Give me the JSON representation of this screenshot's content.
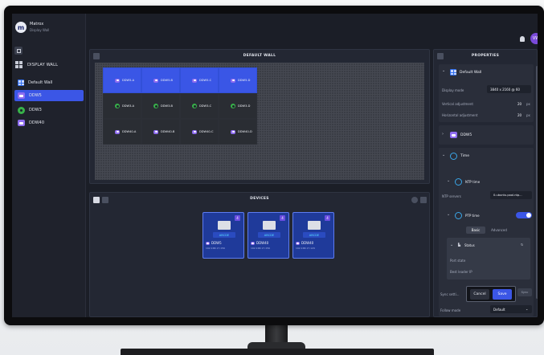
{
  "app": {
    "name": "Matrox",
    "subtitle": "Display Wall",
    "user_initials": "VW"
  },
  "sidebar": {
    "section_label": "DISPLAY WALL",
    "items": [
      {
        "label": "Default Wall",
        "kind": "wall",
        "active": false
      },
      {
        "label": "DDW5",
        "kind": "device",
        "active": true
      },
      {
        "label": "DDW3",
        "kind": "gear",
        "active": false
      },
      {
        "label": "DDW40",
        "kind": "device",
        "active": false
      }
    ]
  },
  "wall": {
    "title": "DEFAULT WALL",
    "tiles": [
      {
        "label": "DDW5-A",
        "style": "blue",
        "icon": "device"
      },
      {
        "label": "DDW5-B",
        "style": "blue",
        "icon": "device"
      },
      {
        "label": "DDW5-C",
        "style": "blue",
        "icon": "device"
      },
      {
        "label": "DDW5-D",
        "style": "blue",
        "icon": "device"
      },
      {
        "label": "DDW3-A",
        "style": "dark",
        "icon": "gear"
      },
      {
        "label": "DDW3-B",
        "style": "dark",
        "icon": "gear"
      },
      {
        "label": "DDW3-C",
        "style": "dark",
        "icon": "gear"
      },
      {
        "label": "DDW3-D",
        "style": "dark",
        "icon": "gear"
      },
      {
        "label": "DDW40-A",
        "style": "dark",
        "icon": "device"
      },
      {
        "label": "DDW40-B",
        "style": "dark",
        "icon": "device"
      },
      {
        "label": "DDW40-C",
        "style": "dark",
        "icon": "device"
      },
      {
        "label": "DDW40-D",
        "style": "dark",
        "icon": "device"
      }
    ]
  },
  "devices": {
    "title": "DEVICES",
    "cards": [
      {
        "badge": "4",
        "code": "ABCDE",
        "name": "DDW5",
        "ip": "192.168.17.156"
      },
      {
        "badge": "4",
        "code": "ABCDE",
        "name": "DDW40",
        "ip": "192.168.17.156"
      },
      {
        "badge": "4",
        "code": "ABCDE",
        "name": "DDW40",
        "ip": "192.168.17.129"
      }
    ]
  },
  "properties": {
    "title": "PROPERTIES",
    "wall_section": {
      "title": "Default Wall",
      "display_mode_label": "Display mode",
      "display_mode_value": "3840 x 2160 @ 60",
      "vertical_label": "Vertical adjustment",
      "vertical_value": "20",
      "horizontal_label": "Horizontal adjustment",
      "horizontal_value": "20",
      "unit": "px"
    },
    "device_section": {
      "title": "DDW5"
    },
    "time_section": {
      "title": "Time"
    },
    "ntp": {
      "title": "NTP time",
      "servers_label": "NTP servers",
      "servers_value": "0.ubuntu.pool.ntp..."
    },
    "ptp": {
      "title": "PTP time",
      "tab_basic": "Basic",
      "tab_advanced": "Advanced"
    },
    "status": {
      "title": "Status",
      "port_state": "Port state",
      "best_leader": "Best leader IP"
    },
    "footer": {
      "sync_label": "Sync setti...",
      "cancel": "Cancel",
      "save": "Save",
      "sync_btn": "Sync",
      "follow_label": "Follow mode",
      "follow_value": "Default"
    }
  }
}
